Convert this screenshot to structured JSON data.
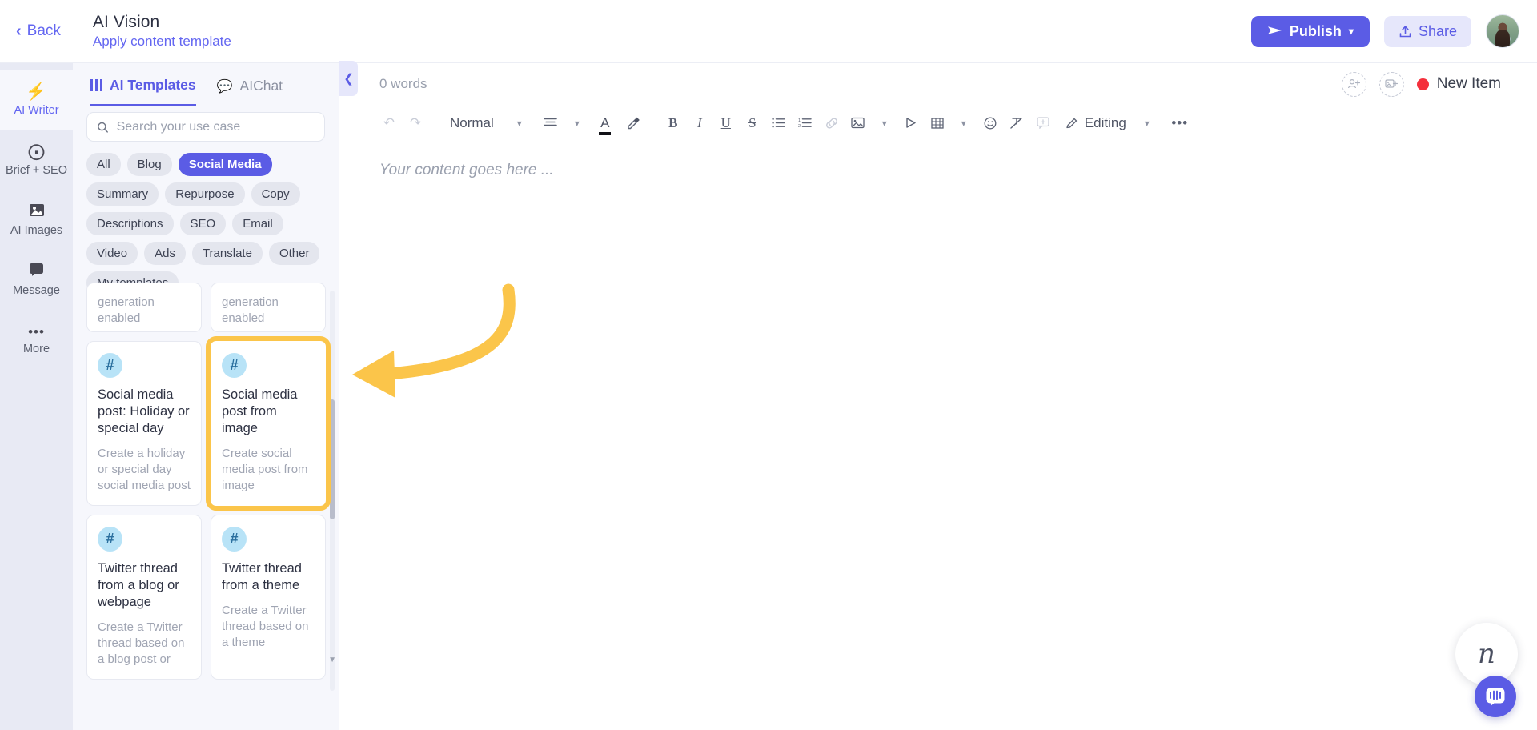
{
  "header": {
    "back_label": "Back",
    "doc_title": "AI Vision",
    "doc_subtitle": "Apply content template",
    "publish_label": "Publish",
    "share_label": "Share"
  },
  "rail": {
    "items": [
      {
        "label": "AI Writer",
        "icon": "lightning-bolt-icon",
        "glyph": "⚡",
        "active": true
      },
      {
        "label": "Brief + SEO",
        "icon": "target-icon",
        "glyph": "⌖",
        "active": false
      },
      {
        "label": "AI Images",
        "icon": "image-icon",
        "glyph": "ὛC",
        "active": false
      },
      {
        "label": "Message",
        "icon": "message-icon",
        "glyph": "ὊC",
        "active": false
      },
      {
        "label": "More",
        "icon": "ellipsis-icon",
        "glyph": "•••",
        "active": false
      }
    ]
  },
  "panel": {
    "tabs": [
      {
        "label": "AI Templates",
        "icon": "templates-grid-icon",
        "active": true
      },
      {
        "label": "AIChat",
        "icon": "chat-bubbles-icon",
        "active": false
      }
    ],
    "search_placeholder": "Search your use case",
    "search_value": "",
    "chips": [
      {
        "label": "All",
        "active": false
      },
      {
        "label": "Blog",
        "active": false
      },
      {
        "label": "Social Media",
        "active": true
      },
      {
        "label": "Summary",
        "active": false
      },
      {
        "label": "Repurpose",
        "active": false
      },
      {
        "label": "Copy",
        "active": false
      },
      {
        "label": "Descriptions",
        "active": false
      },
      {
        "label": "SEO",
        "active": false
      },
      {
        "label": "Email",
        "active": false
      },
      {
        "label": "Video",
        "active": false
      },
      {
        "label": "Ads",
        "active": false
      },
      {
        "label": "Translate",
        "active": false
      },
      {
        "label": "Other",
        "active": false
      },
      {
        "label": "My templates",
        "active": false
      }
    ],
    "cards_clipped_top": [
      {
        "text": "generation enabled"
      },
      {
        "text": "generation enabled"
      }
    ],
    "cards": [
      {
        "icon": "hash-icon",
        "title": "Social media post: Holiday or special day",
        "desc": "Create a holiday or special day social media post",
        "highlighted": false
      },
      {
        "icon": "hash-icon",
        "title": "Social media post from image",
        "desc": "Create social media post from image",
        "highlighted": true
      },
      {
        "icon": "hash-icon",
        "title": "Twitter thread from a blog or webpage",
        "desc": "Create a Twitter thread based on a blog post or",
        "highlighted": false
      },
      {
        "icon": "hash-icon",
        "title": "Twitter thread from a theme",
        "desc": "Create a Twitter thread based on a theme",
        "highlighted": false
      }
    ]
  },
  "editor": {
    "word_count": "0 words",
    "new_item_label": "New Item",
    "placeholder": "Your content goes here ...",
    "toolbar": {
      "undo": "undo-icon",
      "redo": "redo-icon",
      "style_value": "Normal",
      "editing_label": "Editing",
      "items": [
        "align-icon",
        "text-color-icon",
        "highlight-icon",
        "bold-icon",
        "italic-icon",
        "underline-icon",
        "strikethrough-icon",
        "bullet-list-icon",
        "numbered-list-icon",
        "link-icon",
        "image-icon",
        "video-icon",
        "table-icon",
        "emoji-icon",
        "clear-format-icon",
        "comment-icon"
      ]
    }
  },
  "colors": {
    "accent": "#5b5ce5",
    "highlight": "#fbc54a",
    "hash_badge": "#b8e3f7",
    "status_dot": "#f4303c"
  },
  "floating": {
    "watermark_glyph": "n",
    "chat_icon": "intercom-chat-icon"
  }
}
